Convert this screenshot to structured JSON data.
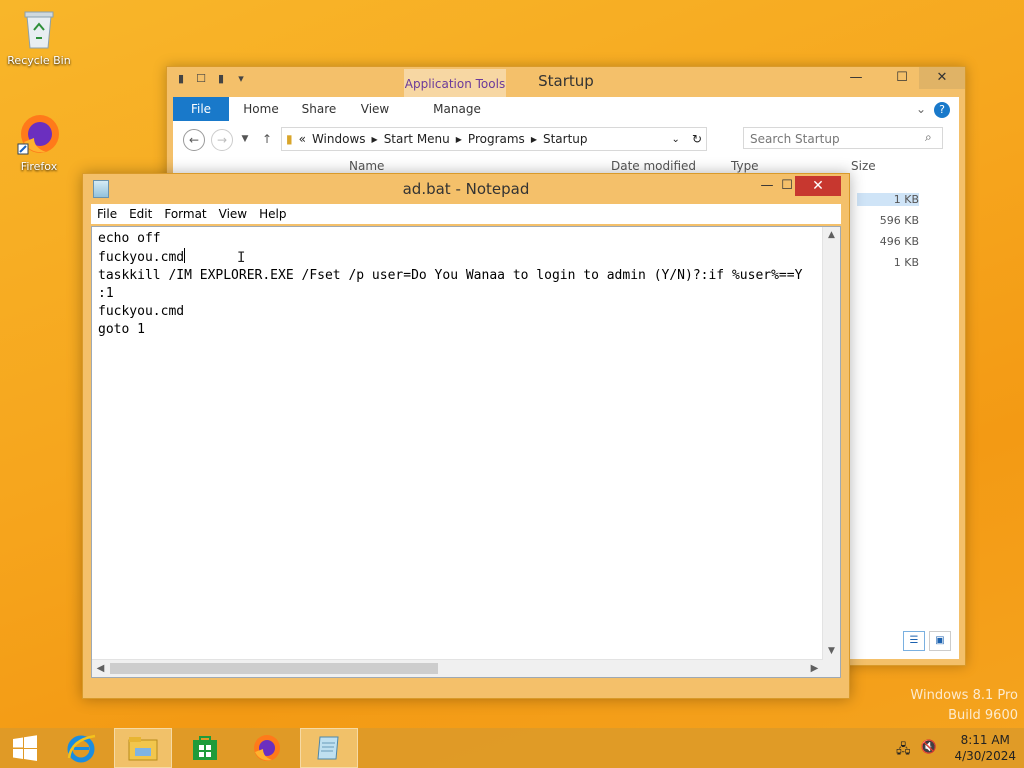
{
  "desktop": {
    "icons": [
      {
        "label": "Recycle Bin",
        "icon": "recycle-bin-icon"
      },
      {
        "label": "Firefox",
        "icon": "firefox-icon"
      }
    ],
    "watermark_line1": "Windows 8.1 Pro",
    "watermark_line2": "Build 9600"
  },
  "explorer": {
    "title": "Startup",
    "contextual_tab": "Application Tools",
    "ribbon_tabs": [
      "File",
      "Home",
      "Share",
      "View",
      "Manage"
    ],
    "address": {
      "prefix": "«",
      "crumbs": [
        "Windows",
        "Start Menu",
        "Programs",
        "Startup"
      ]
    },
    "search_placeholder": "Search Startup",
    "columns": {
      "name": "Name",
      "date": "Date modified",
      "type": "Type",
      "size": "Size"
    },
    "file_sizes": [
      "1 KB",
      "596 KB",
      "496 KB",
      "1 KB"
    ]
  },
  "notepad": {
    "title": "ad.bat - Notepad",
    "menu": [
      "File",
      "Edit",
      "Format",
      "View",
      "Help"
    ],
    "lines": [
      "echo off",
      "fuckyou.cmd",
      "taskkill /IM EXPLORER.EXE /Fset /p user=Do You Wanaa to login to admin (Y/N)?:if %user%==Y",
      ":1",
      "fuckyou.cmd",
      "goto 1"
    ]
  },
  "taskbar": {
    "items": [
      "start-icon",
      "internet-explorer-icon",
      "file-explorer-icon",
      "store-icon",
      "firefox-icon",
      "notepad-icon"
    ],
    "time": "8:11 AM",
    "date": "4/30/2024"
  },
  "colors": {
    "accent_file_tab": "#1979ca",
    "close_button": "#c7372f",
    "wallpaper": "#f6a51d"
  }
}
